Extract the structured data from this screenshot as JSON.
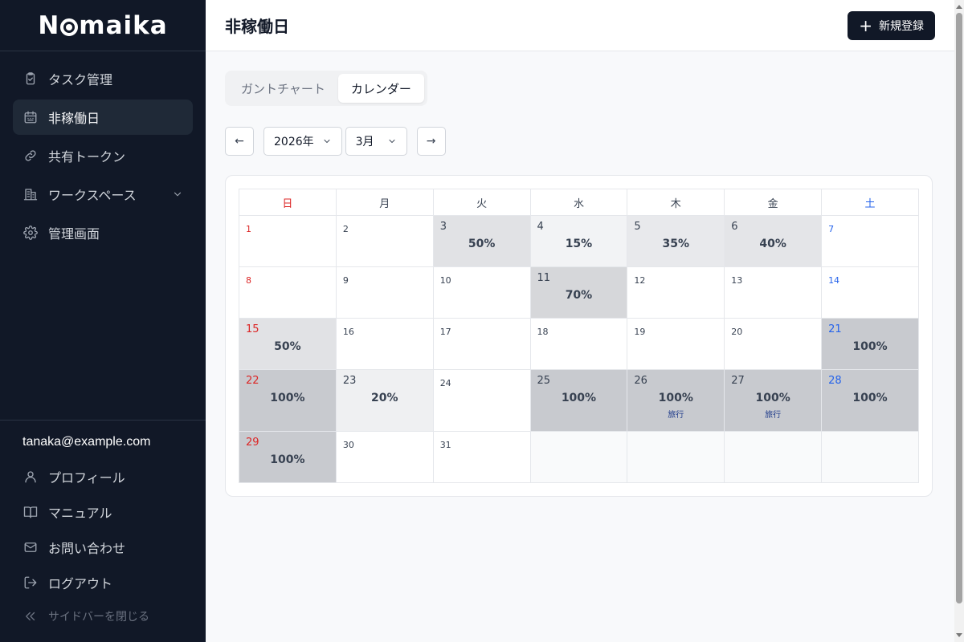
{
  "app": {
    "logo_text_left": "N",
    "logo_text_right": "maika"
  },
  "sidebar": {
    "items": [
      {
        "label": "タスク管理",
        "icon": "clipboard-icon",
        "active": false
      },
      {
        "label": "非稼働日",
        "icon": "calendar-icon",
        "active": true
      },
      {
        "label": "共有トークン",
        "icon": "link-icon",
        "active": false
      },
      {
        "label": "ワークスペース",
        "icon": "building-icon",
        "active": false
      },
      {
        "label": "管理画面",
        "icon": "gear-icon",
        "active": false
      }
    ],
    "user_email": "tanaka@example.com",
    "bottom_items": [
      {
        "label": "プロフィール",
        "icon": "user-icon"
      },
      {
        "label": "マニュアル",
        "icon": "book-icon"
      },
      {
        "label": "お問い合わせ",
        "icon": "mail-icon"
      },
      {
        "label": "ログアウト",
        "icon": "logout-icon"
      }
    ],
    "collapse_label": "サイドバーを閉じる"
  },
  "header": {
    "title": "非稼働日",
    "new_button_label": "新規登録"
  },
  "tabs": [
    {
      "label": "ガントチャート",
      "active": false
    },
    {
      "label": "カレンダー",
      "active": true
    }
  ],
  "controls": {
    "prev_label": "←",
    "next_label": "→",
    "year": "2026年",
    "month": "3月"
  },
  "calendar": {
    "weekdays": [
      "日",
      "月",
      "火",
      "水",
      "木",
      "金",
      "土"
    ],
    "weeks": [
      [
        {
          "day": "1",
          "pct": 0
        },
        {
          "day": "2",
          "pct": 0
        },
        {
          "day": "3",
          "pct": 50
        },
        {
          "day": "4",
          "pct": 15
        },
        {
          "day": "5",
          "pct": 35
        },
        {
          "day": "6",
          "pct": 40
        },
        {
          "day": "7",
          "pct": 0
        }
      ],
      [
        {
          "day": "8",
          "pct": 0
        },
        {
          "day": "9",
          "pct": 0
        },
        {
          "day": "10",
          "pct": 0
        },
        {
          "day": "11",
          "pct": 70
        },
        {
          "day": "12",
          "pct": 0
        },
        {
          "day": "13",
          "pct": 0
        },
        {
          "day": "14",
          "pct": 0
        }
      ],
      [
        {
          "day": "15",
          "pct": 50
        },
        {
          "day": "16",
          "pct": 0
        },
        {
          "day": "17",
          "pct": 0
        },
        {
          "day": "18",
          "pct": 0
        },
        {
          "day": "19",
          "pct": 0
        },
        {
          "day": "20",
          "pct": 0
        },
        {
          "day": "21",
          "pct": 100
        }
      ],
      [
        {
          "day": "22",
          "pct": 100
        },
        {
          "day": "23",
          "pct": 20
        },
        {
          "day": "24",
          "pct": 0
        },
        {
          "day": "25",
          "pct": 100
        },
        {
          "day": "26",
          "pct": 100,
          "note": "旅行"
        },
        {
          "day": "27",
          "pct": 100,
          "note": "旅行"
        },
        {
          "day": "28",
          "pct": 100
        }
      ],
      [
        {
          "day": "29",
          "pct": 100
        },
        {
          "day": "30",
          "pct": 0
        },
        {
          "day": "31",
          "pct": 0
        },
        null,
        null,
        null,
        null
      ]
    ],
    "row_heights": [
      64,
      64,
      64,
      77,
      64
    ]
  }
}
